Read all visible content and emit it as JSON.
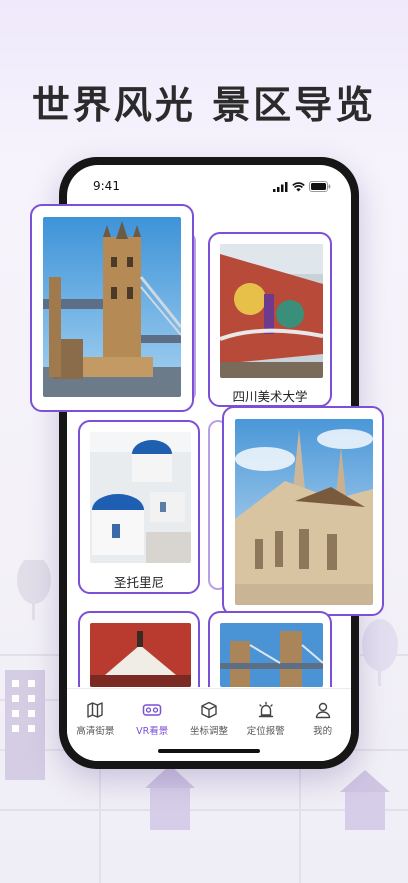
{
  "headline": "世界风光 景区导览",
  "status_bar": {
    "time": "9:41"
  },
  "cards": {
    "tower_bridge": {
      "caption": ""
    },
    "sichuan_art": {
      "caption": "四川美术大学"
    },
    "santorini": {
      "caption": "圣托里尼"
    },
    "matthias_church": {
      "caption": ""
    }
  },
  "tabs": [
    {
      "label": "高清街景",
      "icon": "map-icon",
      "active": false
    },
    {
      "label": "VR看景",
      "icon": "vr-goggles-icon",
      "active": true
    },
    {
      "label": "坐标调整",
      "icon": "cube-icon",
      "active": false
    },
    {
      "label": "定位报警",
      "icon": "alarm-light-icon",
      "active": false
    },
    {
      "label": "我的",
      "icon": "person-icon",
      "active": false
    }
  ],
  "colors": {
    "accent": "#7b4fd6",
    "text": "#2b2b2b"
  }
}
